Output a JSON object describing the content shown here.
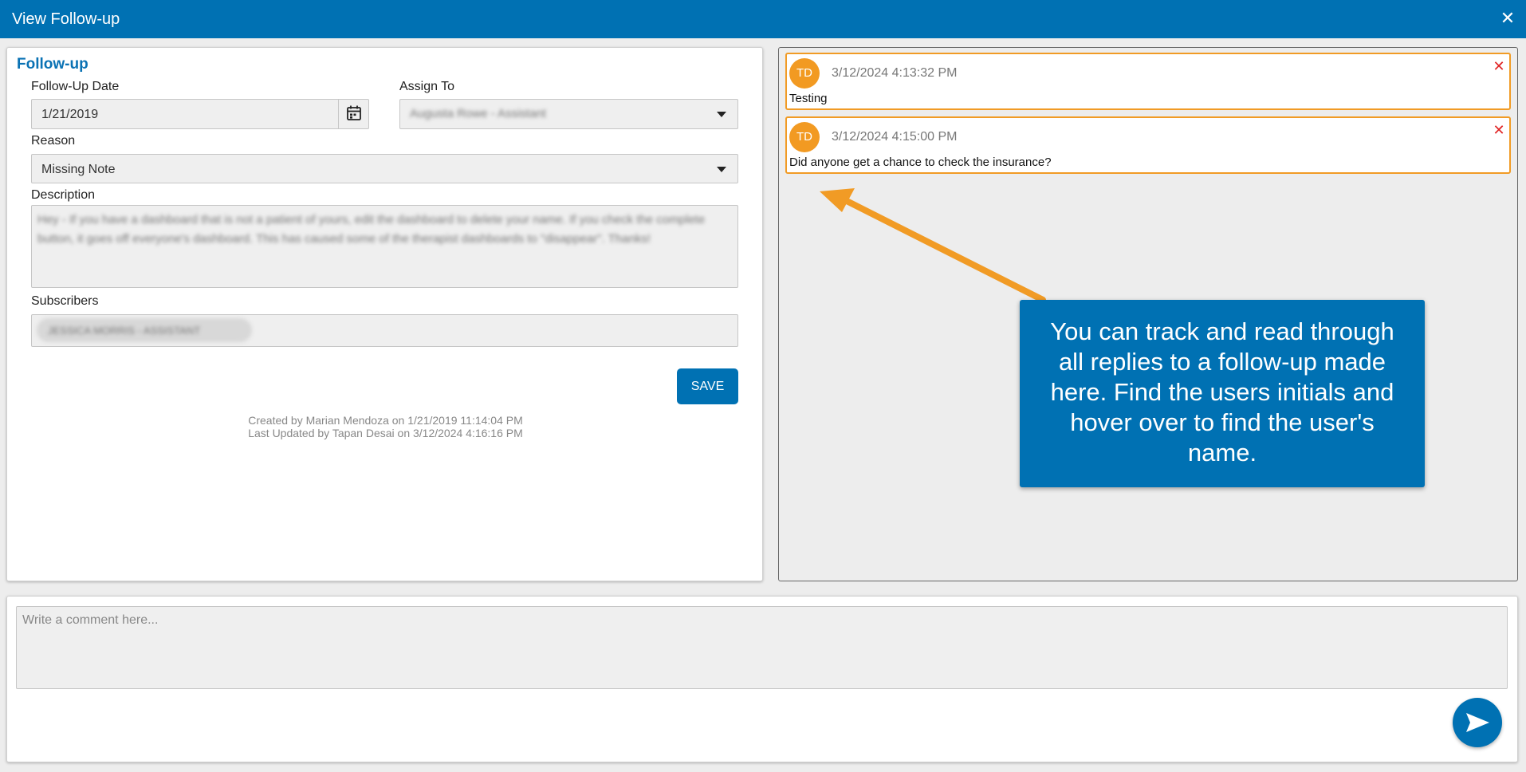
{
  "window": {
    "title": "View Follow-up",
    "close_glyph": "✕"
  },
  "form": {
    "heading": "Follow-up",
    "followup_date": {
      "label": "Follow-Up Date",
      "value": "1/21/2019"
    },
    "assign_to": {
      "label": "Assign To",
      "value": "Augusta Rowe - Assistant"
    },
    "reason": {
      "label": "Reason",
      "value": "Missing Note"
    },
    "description": {
      "label": "Description",
      "value": "Hey - If you have a dashboard that is not a patient of yours, edit the dashboard to delete your name. If you check the complete button, it goes off everyone's dashboard. This has caused some of the therapist dashboards to \"disappear\". Thanks!"
    },
    "subscribers": {
      "label": "Subscribers",
      "chip": "JESSICA MORRIS - ASSISTANT"
    },
    "save_label": "SAVE",
    "created_text": "Created by Marian Mendoza on 1/21/2019 11:14:04 PM",
    "updated_text": "Last Updated by Tapan Desai on 3/12/2024 4:16:16 PM"
  },
  "replies": [
    {
      "initials": "TD",
      "timestamp": "3/12/2024 4:13:32 PM",
      "text": "Testing"
    },
    {
      "initials": "TD",
      "timestamp": "3/12/2024 4:15:00 PM",
      "text": "Did anyone get a chance to check the insurance?"
    }
  ],
  "reply_delete_glyph": "✕",
  "callout": {
    "text": "You can track and read through all replies to a follow-up made here. Find the users initials and hover over to find the user's name."
  },
  "comment": {
    "placeholder": "Write a comment here..."
  },
  "colors": {
    "primary": "#0071b3",
    "accent_orange": "#f19b25",
    "delete_red": "#e02424"
  },
  "icons": {
    "close": "close-icon",
    "calendar": "calendar-icon",
    "dropdown": "chevron-down-icon",
    "send": "send-icon"
  }
}
